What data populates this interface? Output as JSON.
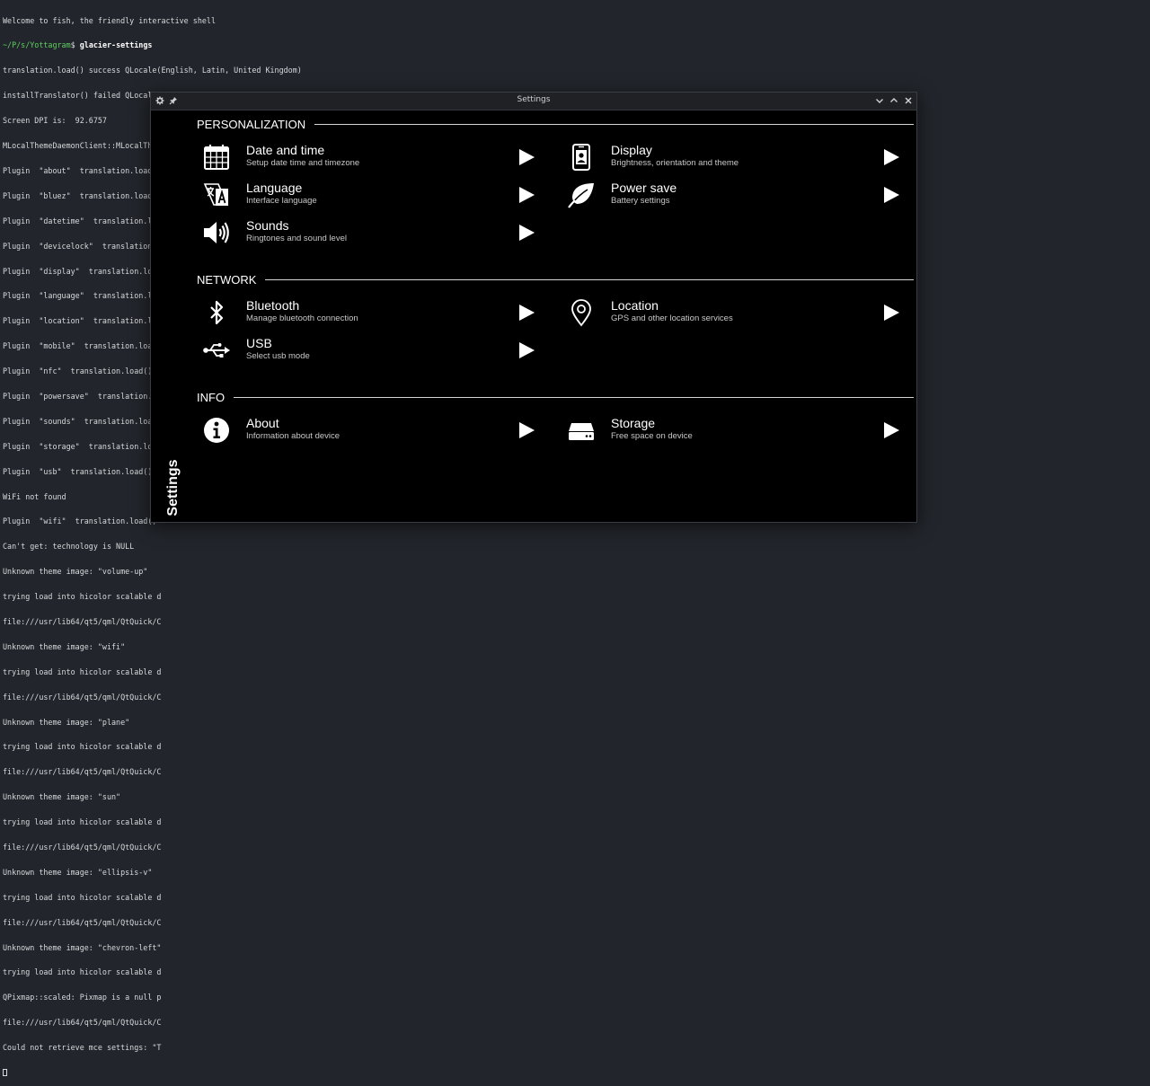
{
  "terminal": {
    "lines": [
      "Welcome to fish, the friendly interactive shell",
      "",
      "translation.load() success QLocale(English, Latin, United Kingdom)",
      "installTranslator() failed QLocale(English, Latin, United Kingdom)",
      "Screen DPI is:  92.6757",
      "MLocalThemeDaemonClient::MLocalThemeDaemonClient(const QString&, QObject*) Theme \"glacier\"  is invalid",
      "Plugin  \"about\"  translation.load() failed \"en_GB\"",
      "Plugin  \"bluez\"  translation.load() failed \"en_GB\"",
      "Plugin  \"datetime\"  translation.load() failed \"en_GB\"",
      "Plugin  \"devicelock\"  translation.load() failed \"en_GB\"",
      "Plugin  \"display\"  translation.load() failed \"en_GB\"",
      "Plugin  \"language\"  translation.loa",
      "Plugin  \"location\"  translation.loa",
      "Plugin  \"mobile\"  translation.load(",
      "Plugin  \"nfc\"  translation.load() f",
      "Plugin  \"powersave\"  translation.lo",
      "Plugin  \"sounds\"  translation.load(",
      "Plugin  \"storage\"  translation.load",
      "Plugin  \"usb\"  translation.load() f",
      "WiFi not found",
      "Plugin  \"wifi\"  translation.load()",
      "Can't get: technology is NULL",
      "Unknown theme image: \"volume-up\"",
      "trying load into hicolor scalable d",
      "file:///usr/lib64/qt5/qml/QtQuick/C",
      "Unknown theme image: \"wifi\"",
      "trying load into hicolor scalable d",
      "file:///usr/lib64/qt5/qml/QtQuick/C",
      "Unknown theme image: \"plane\"",
      "trying load into hicolor scalable d",
      "file:///usr/lib64/qt5/qml/QtQuick/C",
      "Unknown theme image: \"sun\"",
      "trying load into hicolor scalable d",
      "file:///usr/lib64/qt5/qml/QtQuick/C",
      "Unknown theme image: \"ellipsis-v\"",
      "trying load into hicolor scalable d",
      "file:///usr/lib64/qt5/qml/QtQuick/C",
      "Unknown theme image: \"chevron-left\"",
      "trying load into hicolor scalable d",
      "QPixmap::scaled: Pixmap is a null p",
      "file:///usr/lib64/qt5/qml/QtQuick/C",
      "Could not retrieve mce settings: \"T"
    ],
    "prompt_path": "~/P/s/Yottagram",
    "prompt_symbol": "$",
    "command": "glacier-settings"
  },
  "window": {
    "title": "Settings",
    "sidebar_title": "Settings"
  },
  "sections": [
    {
      "title": "PERSONALIZATION",
      "items": [
        {
          "label": "Date and time",
          "desc": "Setup date time and timezone",
          "icon": "calendar-icon"
        },
        {
          "label": "Display",
          "desc": "Brightness, orientation and theme",
          "icon": "phone-icon"
        },
        {
          "label": "Language",
          "desc": "Interface language",
          "icon": "translate-icon"
        },
        {
          "label": "Power save",
          "desc": "Battery settings",
          "icon": "leaf-icon"
        },
        {
          "label": "Sounds",
          "desc": "Ringtones and sound level",
          "icon": "volume-icon"
        }
      ]
    },
    {
      "title": "NETWORK",
      "items": [
        {
          "label": "Bluetooth",
          "desc": "Manage bluetooth connection",
          "icon": "bluetooth-icon"
        },
        {
          "label": "Location",
          "desc": "GPS and other location services",
          "icon": "map-pin-icon"
        },
        {
          "label": "USB",
          "desc": "Select usb mode",
          "icon": "usb-icon"
        }
      ]
    },
    {
      "title": "INFO",
      "items": [
        {
          "label": "About",
          "desc": "Information about device",
          "icon": "info-icon"
        },
        {
          "label": "Storage",
          "desc": "Free space on device",
          "icon": "hard-drive-icon"
        }
      ]
    }
  ]
}
